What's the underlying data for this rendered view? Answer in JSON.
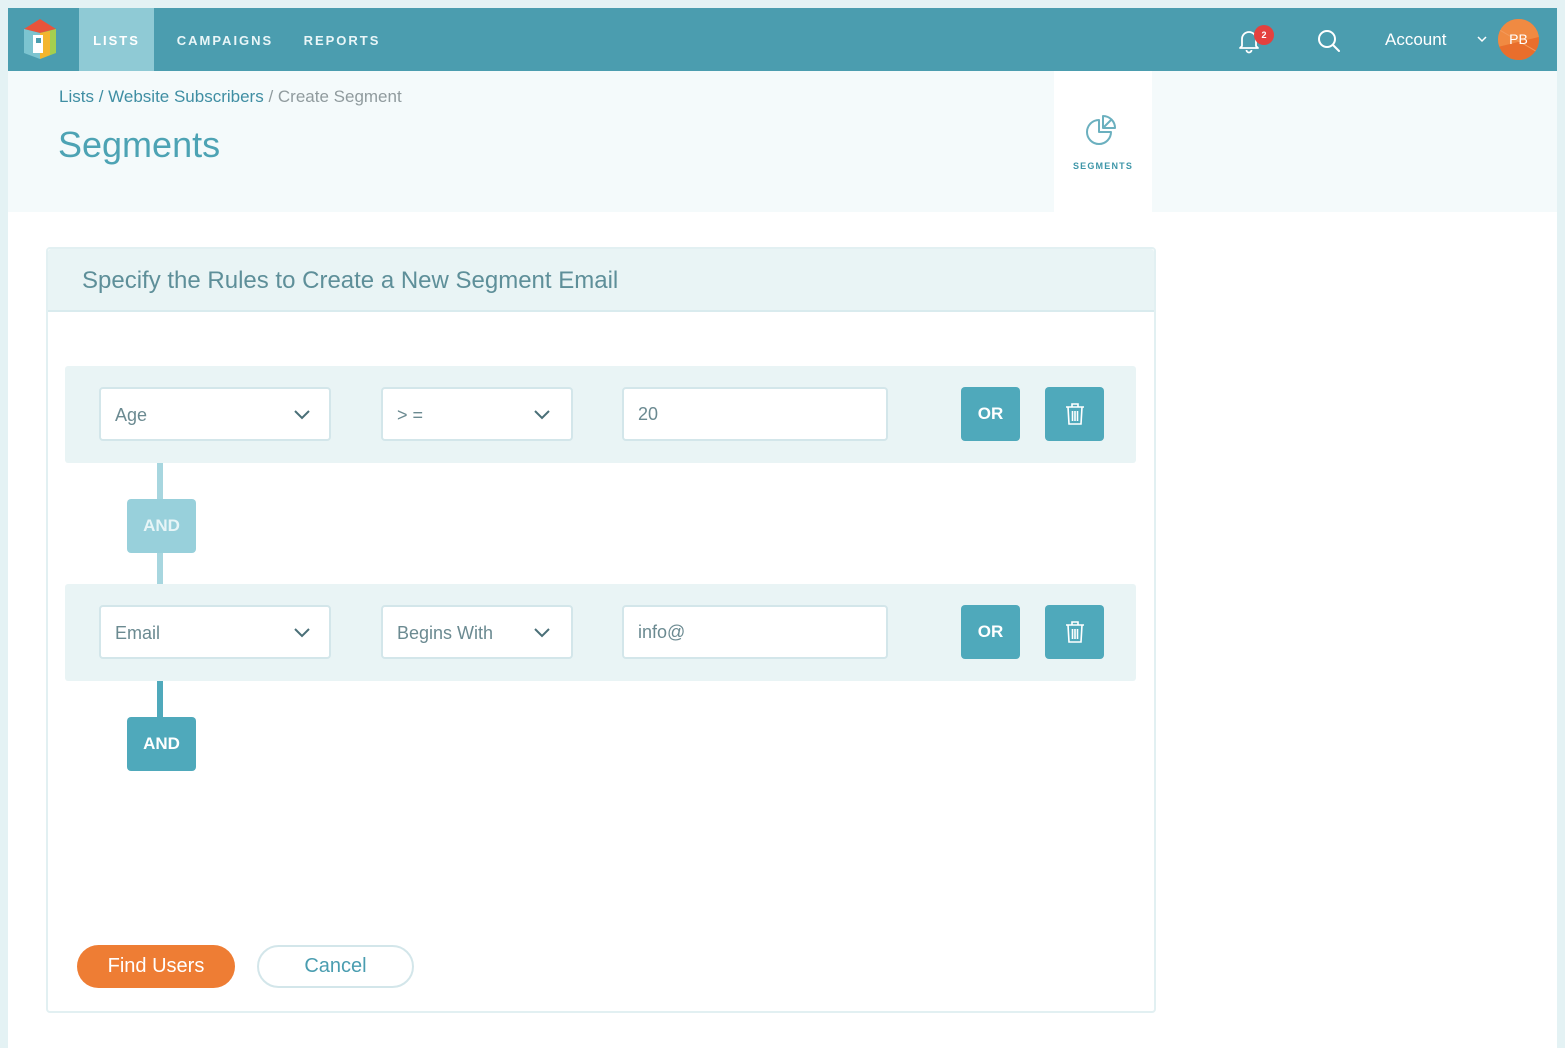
{
  "nav": {
    "items": [
      {
        "label": "LISTS",
        "active": true
      },
      {
        "label": "CAMPAIGNS",
        "active": false
      },
      {
        "label": "REPORTS",
        "active": false
      }
    ],
    "notification_count": "2",
    "account_label": "Account",
    "avatar_initials": "PB"
  },
  "breadcrumb": {
    "lists": "Lists",
    "sep1": " / ",
    "list_name": "Website Subscribers",
    "current": " / Create Segment"
  },
  "page": {
    "title": "Segments",
    "segments_tab_label": "SEGMENTS"
  },
  "panel": {
    "title": "Specify the Rules to Create a New Segment Email",
    "rules": [
      {
        "field": "Age",
        "operator": "> =",
        "value": "20",
        "or_label": "OR"
      },
      {
        "field": "Email",
        "operator": "Begins With",
        "value": "info@",
        "or_label": "OR"
      }
    ],
    "and_labels": [
      "AND",
      "AND"
    ],
    "find_label": "Find Users",
    "cancel_label": "Cancel"
  },
  "colors": {
    "nav_bg": "#4b9daf",
    "accent": "#4fa9bb",
    "primary_button": "#ee7d34",
    "badge": "#e4413e"
  }
}
